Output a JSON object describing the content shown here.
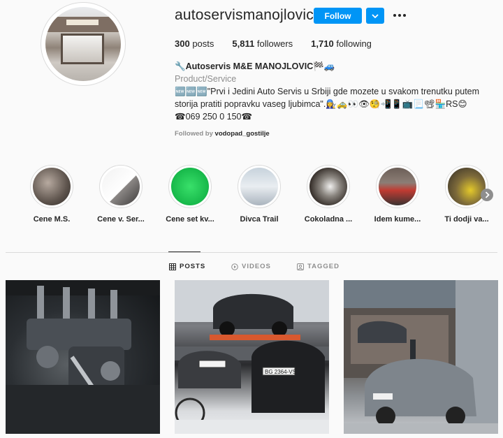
{
  "profile": {
    "username": "autoservismanojlovic",
    "follow_label": "Follow",
    "stats": {
      "posts": "300",
      "posts_label": "posts",
      "followers": "5,811",
      "followers_label": "followers",
      "following": "1,710",
      "following_label": "following"
    },
    "bio": {
      "name": "🔧Autoservis M&E MANOJLOVIC🏁🚙",
      "category": "Product/Service",
      "description": "🆕🆕🆕\"Prvi i Jedini Auto Servis u Srbiji gde mozete u svakom trenutku putem storija pratiti popravku vaseg ljubimca\".👩‍🔧🚕👀👁🧐📲📱📺📃📽🏪RS😊",
      "phone": "☎069 250 0 150☎"
    },
    "followed_by_prefix": "Followed by",
    "followed_by_user": "vodopad_gostilje"
  },
  "highlights": [
    {
      "label": "Cene M.S."
    },
    {
      "label": "Cene v. Ser..."
    },
    {
      "label": "Cene set kv..."
    },
    {
      "label": "Divca Trail"
    },
    {
      "label": "Cokoladna ..."
    },
    {
      "label": "Idem kume..."
    },
    {
      "label": "Ti dodji va..."
    }
  ],
  "tabs": {
    "posts": "POSTS",
    "videos": "VIDEOS",
    "tagged": "TAGGED"
  },
  "plate_2": "BG 2364-VS",
  "colors": {
    "accent": "#0095f6",
    "text": "#262626",
    "muted": "#8e8e8e"
  }
}
